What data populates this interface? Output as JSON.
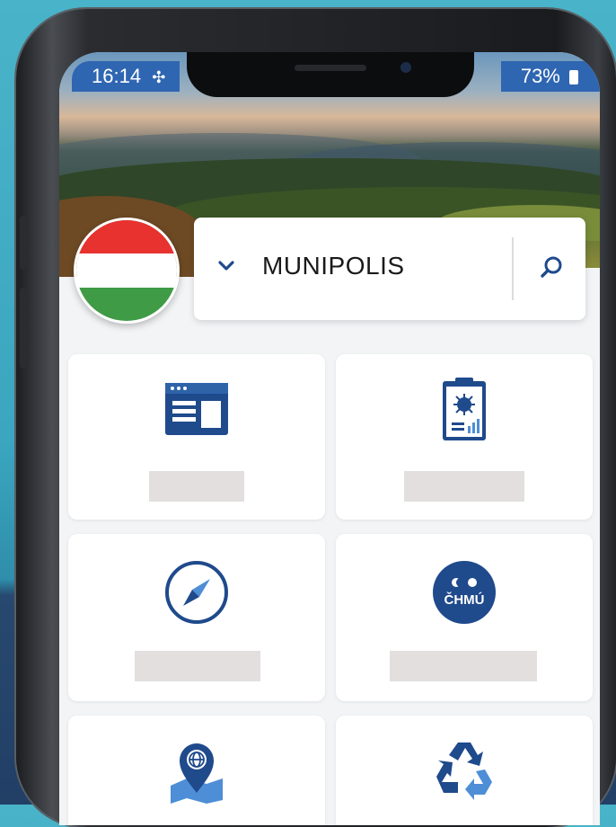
{
  "status_bar": {
    "time": "16:14",
    "battery": "73%"
  },
  "header": {
    "app_name": "MUNIPOLIS",
    "flag": "hungary-flag"
  },
  "tiles": [
    {
      "icon": "news-webpage-icon"
    },
    {
      "icon": "covid-report-icon"
    },
    {
      "icon": "compass-icon"
    },
    {
      "icon": "chmu-weather-icon",
      "icon_text": "ČHMÚ"
    },
    {
      "icon": "map-location-icon"
    },
    {
      "icon": "recycling-icon"
    }
  ],
  "colors": {
    "accent": "#1f4a8c",
    "status_blue": "#2f66b2",
    "placeholder": "#e3dfdf"
  }
}
